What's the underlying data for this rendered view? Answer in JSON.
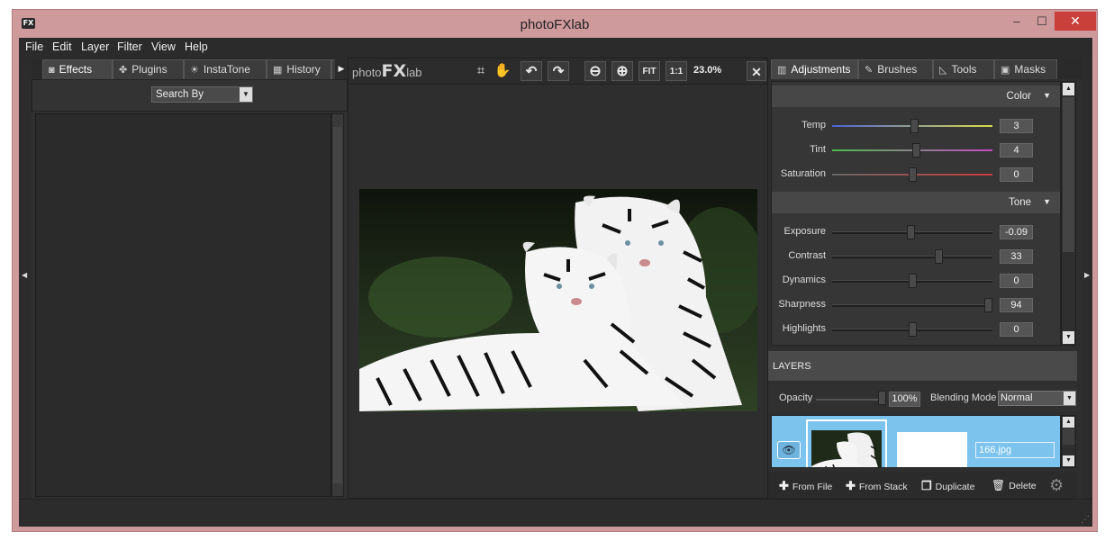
{
  "window": {
    "title": "photoFXlab",
    "app_icon_text": "FX",
    "controls": {
      "minimize": "–",
      "maximize": "☐",
      "close": "✕"
    }
  },
  "menu": [
    "File",
    "Edit",
    "Layer",
    "Filter",
    "View",
    "Help"
  ],
  "left_panel": {
    "tabs": [
      {
        "label": "Effects",
        "icon": "camera-icon",
        "glyph": "◙"
      },
      {
        "label": "Plugins",
        "icon": "puzzle-icon",
        "glyph": "✤"
      },
      {
        "label": "InstaTone",
        "icon": "sun-icon",
        "glyph": "☀"
      },
      {
        "label": "History",
        "icon": "film-icon",
        "glyph": "▦"
      }
    ],
    "search_by": "Search By"
  },
  "center_panel": {
    "logo": {
      "prefix": "photo",
      "emphasis": "FX",
      "suffix": "lab"
    },
    "tools": {
      "crop": "⌗",
      "pan": "✋",
      "undo": "↶",
      "redo": "↷",
      "zoom_out": "⊖",
      "zoom_in": "⊕",
      "fit": "FIT",
      "actual_size": "1:1",
      "close": "✕"
    },
    "zoom": "23.0%"
  },
  "right_panel": {
    "tabs": [
      {
        "label": "Adjustments",
        "icon": "sliders-icon",
        "glyph": "▥"
      },
      {
        "label": "Brushes",
        "icon": "brush-icon",
        "glyph": "✎"
      },
      {
        "label": "Tools",
        "icon": "ruler-icon",
        "glyph": "◺"
      },
      {
        "label": "Masks",
        "icon": "mask-icon",
        "glyph": "▣"
      }
    ],
    "color_section": {
      "title": "Color",
      "sliders": [
        {
          "label": "Temp",
          "value": "3",
          "level": 0.51
        },
        {
          "label": "Tint",
          "value": "4",
          "level": 0.52
        },
        {
          "label": "Saturation",
          "value": "0",
          "level": 0.5
        }
      ]
    },
    "tone_section": {
      "title": "Tone",
      "sliders": [
        {
          "label": "Exposure",
          "value": "-0.09",
          "level": 0.49
        },
        {
          "label": "Contrast",
          "value": "33",
          "level": 0.665
        },
        {
          "label": "Dynamics",
          "value": "0",
          "level": 0.5
        },
        {
          "label": "Sharpness",
          "value": "94",
          "level": 0.97
        },
        {
          "label": "Highlights",
          "value": "0",
          "level": 0.5
        }
      ]
    },
    "layers": {
      "title": "LAYERS",
      "opacity_label": "Opacity",
      "opacity_value": "100%",
      "blending_label": "Blending Mode",
      "blending_value": "Normal",
      "layer_name": "166.jpg",
      "actions": [
        {
          "label": "From File",
          "icon": "plus-icon",
          "glyph": "✚"
        },
        {
          "label": "From Stack",
          "icon": "plus-icon",
          "glyph": "✚"
        },
        {
          "label": "Duplicate",
          "icon": "duplicate-icon",
          "glyph": "❐"
        },
        {
          "label": "Delete",
          "icon": "trash-icon",
          "glyph": "🗑"
        }
      ]
    }
  },
  "colors": {
    "accent_selected_layer": "#7cc3ee",
    "close_button": "#c9403a",
    "window_frame": "#cf9a9c"
  }
}
